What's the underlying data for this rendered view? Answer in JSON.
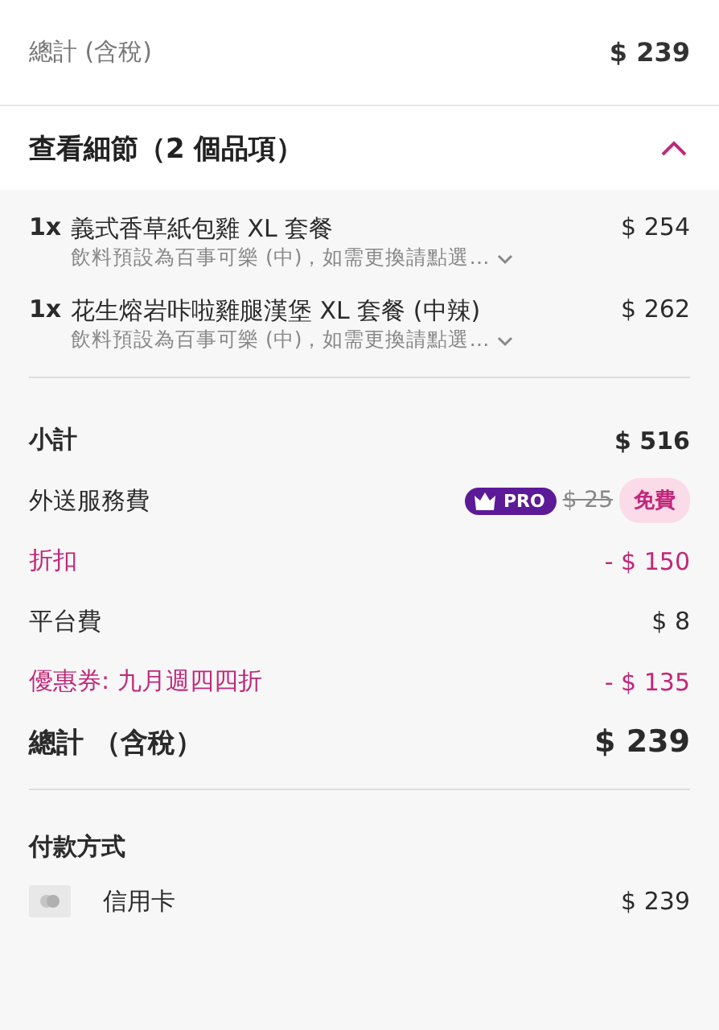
{
  "summary": {
    "label": "總計 (含稅)",
    "amount": "$ 239"
  },
  "details": {
    "title": "查看細節（2 個品項）",
    "expanded": true,
    "items": [
      {
        "qty": "1x",
        "name": "義式香草紙包雞 XL 套餐",
        "note": "飲料預設為百事可樂 (中)，如需更換請點選…",
        "price": "$ 254"
      },
      {
        "qty": "1x",
        "name": "花生熔岩咔啦雞腿漢堡 XL 套餐 (中辣)",
        "note": "飲料預設為百事可樂 (中)，如需更換請點選…",
        "price": "$ 262"
      }
    ]
  },
  "fees": [
    {
      "kind": "bold",
      "label": "小計",
      "amount": "$ 516"
    },
    {
      "kind": "delivery",
      "label": "外送服務費",
      "badge": "PRO",
      "original": "$ 25",
      "amount": "免費"
    },
    {
      "kind": "discount",
      "label": "折扣",
      "amount": "- $ 150"
    },
    {
      "kind": "normal",
      "label": "平台費",
      "amount": "$ 8"
    },
    {
      "kind": "discount",
      "label": "優惠券: 九月週四四折",
      "amount": "- $ 135"
    },
    {
      "kind": "total",
      "label": "總計 （含稅）",
      "amount": "$ 239"
    }
  ],
  "payment": {
    "title": "付款方式",
    "method": "信用卡",
    "amount": "$ 239"
  }
}
